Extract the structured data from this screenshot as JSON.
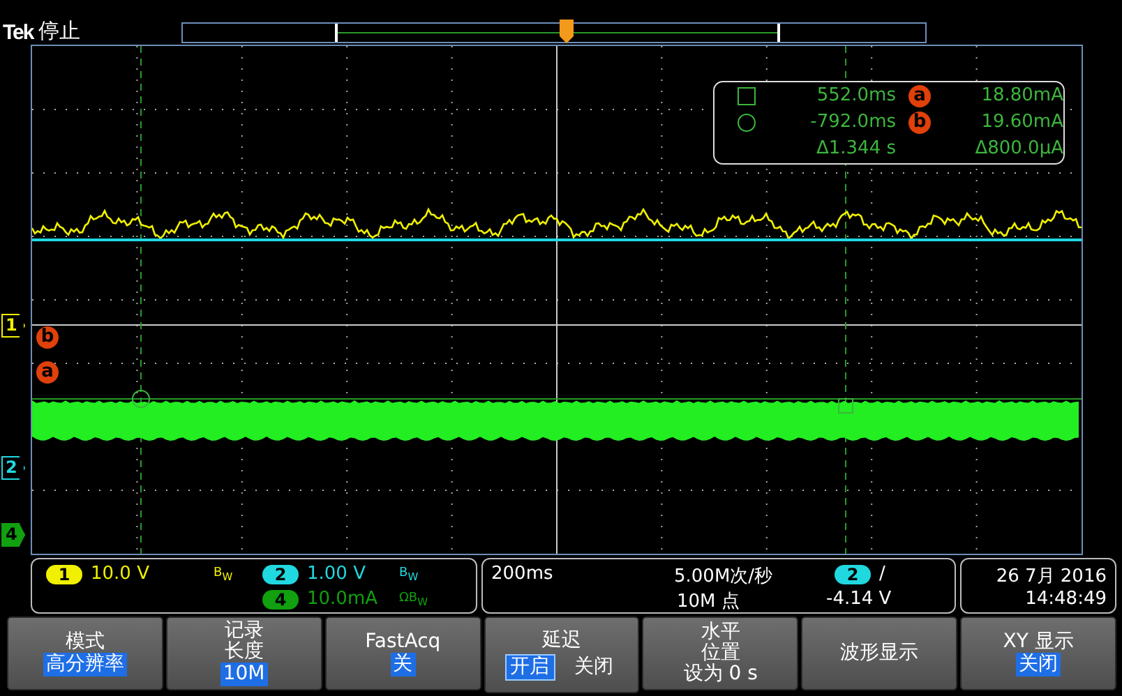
{
  "header": {
    "brand": "Tek",
    "status": "停止"
  },
  "cursor_readout": {
    "rows": [
      {
        "kind": "square",
        "time": "552.0ms",
        "label": "a",
        "value": "18.80mA"
      },
      {
        "kind": "circle",
        "time": "-792.0ms",
        "label": "b",
        "value": "19.60mA"
      }
    ],
    "delta_time": "Δ1.344 s",
    "delta_value": "Δ800.0µA"
  },
  "channel_markers": [
    {
      "label": "1",
      "color": "#f0f000"
    },
    {
      "label": "2",
      "color": "#20d8e0"
    },
    {
      "label": "4",
      "color": "#10a010"
    }
  ],
  "cursor_markers": [
    {
      "label": "b"
    },
    {
      "label": "a"
    }
  ],
  "channels": [
    {
      "badge": "1",
      "color": "#f0f000",
      "scale": "10.0 V",
      "bw": "B$_{W}$"
    },
    {
      "badge": "2",
      "color": "#20d8e0",
      "scale": "1.00 V",
      "bw": "B$_{W}$"
    },
    {
      "badge": "4",
      "color": "#10a010",
      "scale": "10.0mA",
      "bw": "ΩB$_{W}$"
    }
  ],
  "horizontal": {
    "scale": "200ms",
    "sample_rate": "5.00M次/秒",
    "record": "10M 点",
    "trigger_source": "2",
    "trigger_slope": "/",
    "trigger_level": "-4.14 V"
  },
  "datetime": {
    "date": "26 7月 2016",
    "time": "14:48:49"
  },
  "menu": [
    {
      "kind": "value",
      "label": "模式",
      "value": "高分辨率"
    },
    {
      "kind": "value",
      "label": [
        "记录",
        "长度"
      ],
      "value": "10M"
    },
    {
      "kind": "value",
      "label": "FastAcq",
      "value": "关"
    },
    {
      "kind": "toggle",
      "label": "延迟",
      "options": [
        {
          "label": "开启",
          "selected": true
        },
        {
          "label": "关闭",
          "selected": false
        }
      ]
    },
    {
      "kind": "plain",
      "label": [
        "水平",
        "位置"
      ],
      "value": "设为 0 s"
    },
    {
      "kind": "action",
      "label": "波形显示"
    },
    {
      "kind": "value",
      "label": "XY 显示",
      "value": "关闭"
    }
  ]
}
